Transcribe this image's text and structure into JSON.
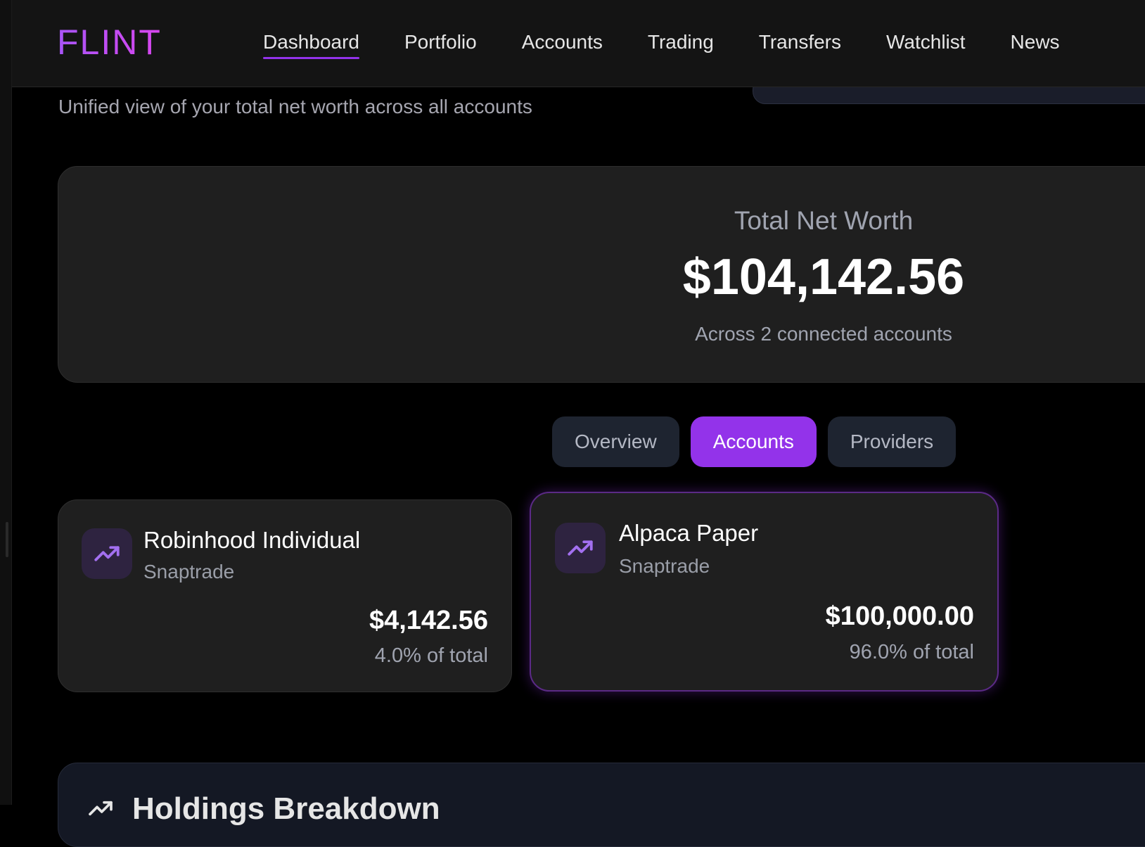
{
  "app": {
    "brand": "FLINT"
  },
  "nav": {
    "items": [
      {
        "label": "Dashboard",
        "active": true
      },
      {
        "label": "Portfolio",
        "active": false
      },
      {
        "label": "Accounts",
        "active": false
      },
      {
        "label": "Trading",
        "active": false
      },
      {
        "label": "Transfers",
        "active": false
      },
      {
        "label": "Watchlist",
        "active": false
      },
      {
        "label": "News",
        "active": false
      }
    ]
  },
  "page": {
    "subtitle": "Unified view of your total net worth across all accounts"
  },
  "networth": {
    "label": "Total Net Worth",
    "value": "$104,142.56",
    "sub": "Across 2 connected accounts"
  },
  "tabs": [
    {
      "label": "Overview",
      "active": false
    },
    {
      "label": "Accounts",
      "active": true
    },
    {
      "label": "Providers",
      "active": false
    }
  ],
  "accounts": [
    {
      "name": "Robinhood Individual",
      "provider": "Snaptrade",
      "value": "$4,142.56",
      "pct": "4.0% of total",
      "icon": "trending-up-icon"
    },
    {
      "name": "Alpaca Paper",
      "provider": "Snaptrade",
      "value": "$100,000.00",
      "pct": "96.0% of total",
      "icon": "trending-up-icon"
    }
  ],
  "holdings": {
    "title": "Holdings Breakdown"
  },
  "colors": {
    "accent": "#9333ea",
    "background": "#000000",
    "card": "#1f1f1f",
    "icon_tile": "#2e2340"
  }
}
